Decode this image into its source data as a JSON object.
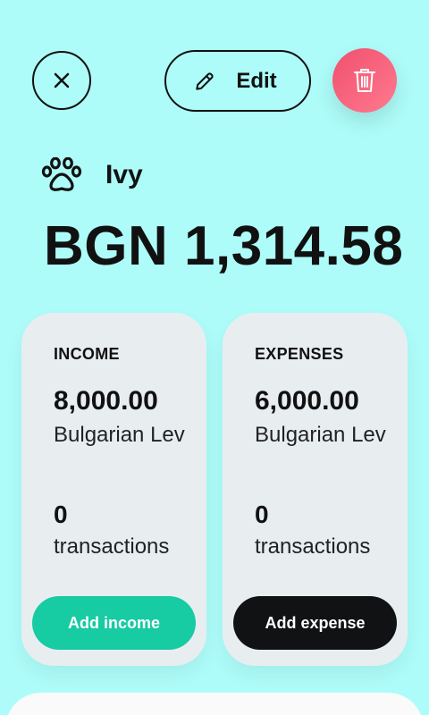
{
  "header": {
    "close_icon": "close-icon",
    "edit_label": "Edit",
    "edit_icon": "pencil-icon",
    "delete_icon": "trash-icon"
  },
  "account": {
    "icon": "paw-icon",
    "name": "Ivy",
    "balance": "BGN 1,314.58"
  },
  "income_card": {
    "label": "INCOME",
    "amount": "8,000.00",
    "currency": "Bulgarian Lev",
    "count": "0",
    "count_label": "transactions",
    "button_label": "Add income"
  },
  "expense_card": {
    "label": "EXPENSES",
    "amount": "6,000.00",
    "currency": "Bulgarian Lev",
    "count": "0",
    "count_label": "transactions",
    "button_label": "Add expense"
  },
  "colors": {
    "background": "#adfcf9",
    "card": "#e8eef0",
    "income_accent": "#17cba2",
    "expense_accent": "#111214",
    "delete_accent": "#f0506e"
  }
}
